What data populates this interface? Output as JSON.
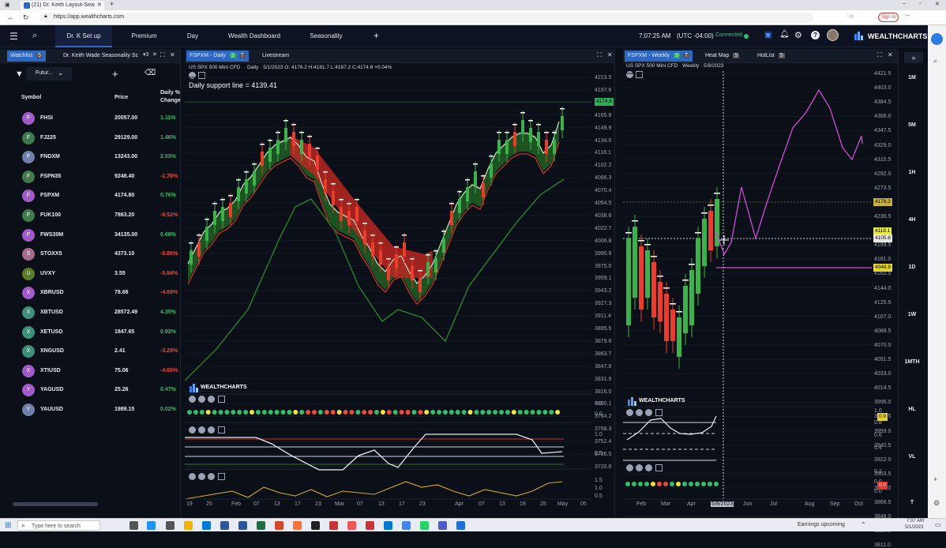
{
  "browser": {
    "tab_title": "(21) Dr. Keith Layout-Seasonal -",
    "url": "https://app.wealthcharts.com",
    "signin_label": "Sign in"
  },
  "nav": {
    "tabs": [
      "Dr. K Set up",
      "Premium",
      "Day",
      "Wealth Dashboard",
      "Seasonality"
    ],
    "active_tab": "Dr. K Set up",
    "time": "7:07:25 AM",
    "timezone": "(UTC -04:00)",
    "status": "Connected",
    "logo": "WEALTHCHARTS"
  },
  "watchlist": {
    "tab1": "Watchlist",
    "tab1_badge": "5",
    "tab2": "Dr. Keith Wade Seasonality Sc",
    "filter_label": "Futur...",
    "col_symbol": "Symbol",
    "col_price": "Price",
    "col_change_1": "Daily %",
    "col_change_2": "Change",
    "rows": [
      {
        "letter": "F",
        "symbol": "FHSI",
        "price": "20057.00",
        "change": "1.11%",
        "avatar_color": "#a259c9",
        "dir": "up"
      },
      {
        "letter": "F",
        "symbol": "FJ225",
        "price": "29129.00",
        "change": "1.46%",
        "avatar_color": "#3f7a4c",
        "dir": "up"
      },
      {
        "letter": "F",
        "symbol": "FNDXM",
        "price": "13243.00",
        "change": "2.03%",
        "avatar_color": "#6e7fa8",
        "dir": "up"
      },
      {
        "letter": "F",
        "symbol": "FSPN35",
        "price": "9248.40",
        "change": "-1.76%",
        "avatar_color": "#3f7a4c",
        "dir": "down"
      },
      {
        "letter": "F",
        "symbol": "FSPXM",
        "price": "4174.80",
        "change": "0.76%",
        "avatar_color": "#a259c9",
        "dir": "up"
      },
      {
        "letter": "F",
        "symbol": "FUK100",
        "price": "7863.20",
        "change": "-0.52%",
        "avatar_color": "#3f7a4c",
        "dir": "down"
      },
      {
        "letter": "F",
        "symbol": "FWS30M",
        "price": "34135.00",
        "change": "0.68%",
        "avatar_color": "#a259c9",
        "dir": "up"
      },
      {
        "letter": "S",
        "symbol": "STOXX5",
        "price": "4373.10",
        "change": "-0.86%",
        "avatar_color": "#a66a8f",
        "dir": "down"
      },
      {
        "letter": "U",
        "symbol": "UVXY",
        "price": "3.55",
        "change": "-5.84%",
        "avatar_color": "#5a7a2a",
        "dir": "down"
      },
      {
        "letter": "X",
        "symbol": "XBRUSD",
        "price": "78.66",
        "change": "-4.69%",
        "avatar_color": "#a259c9",
        "dir": "down"
      },
      {
        "letter": "X",
        "symbol": "XBTUSD",
        "price": "28572.49",
        "change": "4.35%",
        "avatar_color": "#3e8f7a",
        "dir": "up"
      },
      {
        "letter": "X",
        "symbol": "XETUSD",
        "price": "1847.65",
        "change": "0.92%",
        "avatar_color": "#3e8f7a",
        "dir": "up"
      },
      {
        "letter": "X",
        "symbol": "XNGUSD",
        "price": "2.41",
        "change": "-3.29%",
        "avatar_color": "#3e8f7a",
        "dir": "down"
      },
      {
        "letter": "X",
        "symbol": "XTIUSD",
        "price": "75.06",
        "change": "-4.66%",
        "avatar_color": "#a259c9",
        "dir": "down"
      },
      {
        "letter": "Y",
        "symbol": "YAGUSD",
        "price": "25.26",
        "change": "0.47%",
        "avatar_color": "#a259c9",
        "dir": "up"
      },
      {
        "letter": "Y",
        "symbol": "YAUUSD",
        "price": "1989.15",
        "change": "0.02%",
        "avatar_color": "#6e7fa8",
        "dir": "up"
      }
    ]
  },
  "daily": {
    "tab": "FSPXM - Daily",
    "tab_badge1": "3",
    "tab_badge2": "T",
    "tab2": "Livestream",
    "info_title": "US SPX 500 Mini CFD",
    "info_ohlc": "· Daily · 5/1/2023 O: 4176.2 H:4181.7 L:4167.2 C:4174.6 +0.04%",
    "annotation": "Daily support line = 4139.41",
    "price_tag": "4174.8",
    "y_labels": [
      "4213.5",
      "4197.6",
      "4181.7",
      "4165.8",
      "4149.9",
      "4134.0",
      "4118.1",
      "4102.2",
      "4086.3",
      "4070.4",
      "4054.5",
      "4038.6",
      "4022.7",
      "4006.8",
      "3990.9",
      "3975.0",
      "3959.1",
      "3943.2",
      "3927.3",
      "3911.4",
      "3895.5",
      "3879.6",
      "3863.7",
      "3847.8",
      "3831.9",
      "3816.0",
      "3800.1",
      "3784.2",
      "3768.3",
      "3752.4",
      "3736.5",
      "3720.6"
    ],
    "x_labels": [
      "19",
      "25",
      "Feb",
      "07",
      "13",
      "17",
      "23",
      "Mar",
      "07",
      "13",
      "17",
      "23",
      "Apr",
      "07",
      "13",
      "19",
      "25",
      "May",
      "05"
    ],
    "ind_labels": [
      "0.0",
      "0.0",
      "1.0",
      "0.5",
      "1.5",
      "1.0",
      "0.5"
    ],
    "logo": "WEALTHCHARTS"
  },
  "weekly": {
    "tab": "FSPXM - Weekly",
    "tab_badge1": "5",
    "tab_badge2": "T",
    "tab2": "Heat Map",
    "tab2_badge": "5",
    "tab3": "HotList",
    "tab3_badge": "5",
    "info": "US SPX 500 Mini CFD · Weekly · 5/8/2023",
    "tags": [
      "4176.2",
      "4118.1",
      "4105.8",
      "4048.9"
    ],
    "y_labels": [
      "4421.5",
      "4403.0",
      "4384.5",
      "4366.0",
      "4347.5",
      "4329.0",
      "4310.5",
      "4292.0",
      "4273.5",
      "4255.0",
      "4236.5",
      "4218.0",
      "4199.5",
      "4181.0",
      "4162.5",
      "4144.0",
      "4125.5",
      "4107.0",
      "4088.5",
      "4070.0",
      "4051.5",
      "4033.0",
      "4014.5",
      "3996.0",
      "3977.5",
      "3959.0",
      "3940.5",
      "3922.0",
      "3903.5",
      "3885.0",
      "3866.5",
      "3848.0",
      "3829.5",
      "3811.0"
    ],
    "x_labels": [
      "Feb",
      "Mar",
      "Apr",
      "5/8/2023",
      "Jun",
      "Jul",
      "Aug",
      "Sep",
      "Oct"
    ],
    "ind_labels": [
      "1.0",
      "0.8",
      "0.6",
      "0.4",
      "0.2",
      "0.0",
      "0.0"
    ],
    "ind_tag1": "0.9",
    "ind_tag2": "0.0",
    "logo": "WEALTHCHARTS"
  },
  "timeframes": [
    "1M",
    "5M",
    "1H",
    "4H",
    "1D",
    "1W",
    "1MTH",
    "HL",
    "VL",
    "T"
  ],
  "taskbar": {
    "search": "Type here to search",
    "news": "Earnings upcoming",
    "time": "7:07 AM",
    "date": "5/1/2023"
  }
}
